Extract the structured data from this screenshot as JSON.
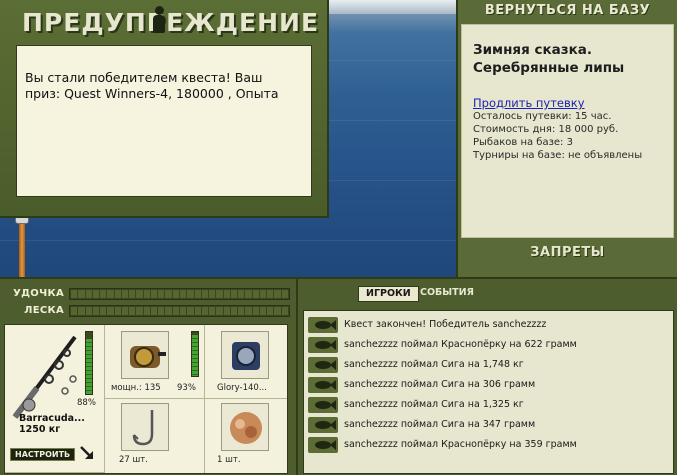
{
  "warning": {
    "title": "ПРЕДУПРЕЖДЕНИЕ",
    "message": "Вы стали победителем квеста! Ваш приз: Quest Winners-4, 180000 , Опыта"
  },
  "right_panel": {
    "back_button": "ВЕРНУТЬСЯ НА БАЗУ",
    "base_name_1": "Зимняя сказка.",
    "base_name_2": "Серебрянные липы",
    "extend_link": "Продлить путевку",
    "info": [
      "Осталось путевки: 15 час.",
      "Стоимость дня: 18 000 руб.",
      "Рыбаков на базе: 3",
      "Турниры на базе: не объявлены"
    ],
    "bans_button": "ЗАПРЕТЫ"
  },
  "gauges": {
    "rod_label": "УДОЧКА",
    "line_label": "ЛЕСКА"
  },
  "gear": {
    "rod_name": "Barracuda...",
    "rod_weight": "1250 кг",
    "rod_condition": "88%",
    "rod_condition_value": 0.88,
    "reel_power": "мощн.: 135",
    "reel_condition": "93%",
    "reel_condition_value": 0.93,
    "line_name": "Glory-140...",
    "hooks_count": "27 шт.",
    "bait_count": "1 шт.",
    "setup_button": "НАСТРОИТЬ"
  },
  "events": {
    "tab_players": "ИГРОКИ",
    "tab_events": "СОБЫТИЯ",
    "lines": [
      "Квест закончен! Победитель sanchezzzz",
      "sanchezzzz поймал Краснопёрку на 622 грамм",
      "sanchezzzz поймал Сига на 1,748 кг",
      "sanchezzzz поймал Сига на 306 грамм",
      "sanchezzzz поймал Сига на 1,325 кг",
      "sanchezzzz поймал Сига на 347 грамм",
      "sanchezzzz поймал Краснопёрку на 359 грамм"
    ]
  },
  "colors": {
    "panel_green": "#5b6b37",
    "cream": "#e7e6cf",
    "link_blue": "#1b22b0"
  }
}
